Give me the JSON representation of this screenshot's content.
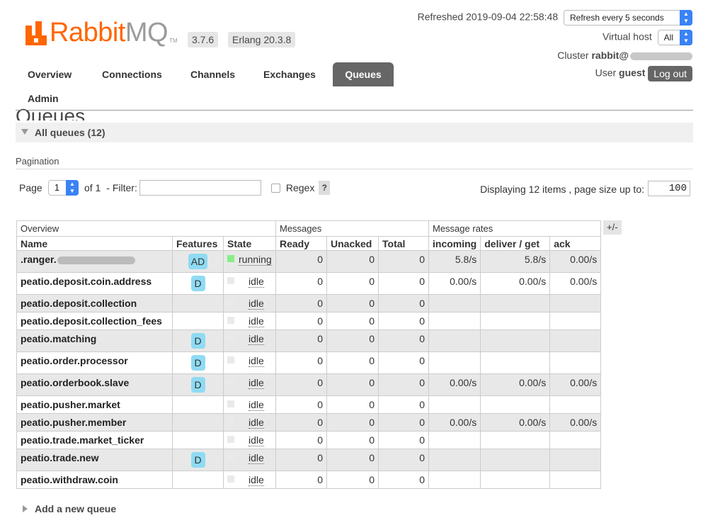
{
  "header": {
    "logo_main": "Rabbit",
    "logo_mq": "MQ",
    "logo_tm": "TM",
    "version": "3.7.6",
    "erlang": "Erlang 20.3.8",
    "refreshed": "Refreshed 2019-09-04 22:58:48",
    "refresh_select": "Refresh every 5 seconds",
    "vhost_label": "Virtual host",
    "vhost_value": "All",
    "cluster_label": "Cluster",
    "cluster_value": "rabbit@",
    "user_label": "User",
    "user_value": "guest",
    "logout": "Log out"
  },
  "tabs": [
    "Overview",
    "Connections",
    "Channels",
    "Exchanges",
    "Queues",
    "Admin"
  ],
  "page": {
    "title": "Queues",
    "section": "All queues (12)",
    "pagination_label": "Pagination",
    "page_label": "Page",
    "page_value": "1",
    "of_label": "of 1",
    "filter_label": "- Filter:",
    "regex_label": "Regex",
    "help": "?",
    "display_info": "Displaying 12 items , page size up to:",
    "page_size": "100",
    "plusminus": "+/-",
    "add_queue": "Add a new queue"
  },
  "table": {
    "groups": [
      "Overview",
      "Messages",
      "Message rates"
    ],
    "columns": [
      "Name",
      "Features",
      "State",
      "Ready",
      "Unacked",
      "Total",
      "incoming",
      "deliver / get",
      "ack"
    ],
    "rows": [
      {
        "name": ".ranger.",
        "feature": "AD",
        "state": "running",
        "ready": "0",
        "unacked": "0",
        "total": "0",
        "incoming": "5.8/s",
        "deliver": "5.8/s",
        "ack": "0.00/s"
      },
      {
        "name": "peatio.deposit.coin.address",
        "feature": "D",
        "state": "idle",
        "ready": "0",
        "unacked": "0",
        "total": "0",
        "incoming": "0.00/s",
        "deliver": "0.00/s",
        "ack": "0.00/s"
      },
      {
        "name": "peatio.deposit.collection",
        "feature": "",
        "state": "idle",
        "ready": "0",
        "unacked": "0",
        "total": "0",
        "incoming": "",
        "deliver": "",
        "ack": ""
      },
      {
        "name": "peatio.deposit.collection_fees",
        "feature": "",
        "state": "idle",
        "ready": "0",
        "unacked": "0",
        "total": "0",
        "incoming": "",
        "deliver": "",
        "ack": ""
      },
      {
        "name": "peatio.matching",
        "feature": "D",
        "state": "idle",
        "ready": "0",
        "unacked": "0",
        "total": "0",
        "incoming": "",
        "deliver": "",
        "ack": ""
      },
      {
        "name": "peatio.order.processor",
        "feature": "D",
        "state": "idle",
        "ready": "0",
        "unacked": "0",
        "total": "0",
        "incoming": "",
        "deliver": "",
        "ack": ""
      },
      {
        "name": "peatio.orderbook.slave",
        "feature": "D",
        "state": "idle",
        "ready": "0",
        "unacked": "0",
        "total": "0",
        "incoming": "0.00/s",
        "deliver": "0.00/s",
        "ack": "0.00/s"
      },
      {
        "name": "peatio.pusher.market",
        "feature": "",
        "state": "idle",
        "ready": "0",
        "unacked": "0",
        "total": "0",
        "incoming": "",
        "deliver": "",
        "ack": ""
      },
      {
        "name": "peatio.pusher.member",
        "feature": "",
        "state": "idle",
        "ready": "0",
        "unacked": "0",
        "total": "0",
        "incoming": "0.00/s",
        "deliver": "0.00/s",
        "ack": "0.00/s"
      },
      {
        "name": "peatio.trade.market_ticker",
        "feature": "",
        "state": "idle",
        "ready": "0",
        "unacked": "0",
        "total": "0",
        "incoming": "",
        "deliver": "",
        "ack": ""
      },
      {
        "name": "peatio.trade.new",
        "feature": "D",
        "state": "idle",
        "ready": "0",
        "unacked": "0",
        "total": "0",
        "incoming": "",
        "deliver": "",
        "ack": ""
      },
      {
        "name": "peatio.withdraw.coin",
        "feature": "",
        "state": "idle",
        "ready": "0",
        "unacked": "0",
        "total": "0",
        "incoming": "",
        "deliver": "",
        "ack": ""
      }
    ]
  },
  "colors": {
    "brand": "#ff6600",
    "tab_active": "#666666",
    "feature_badge": "#8fdbf3",
    "running": "#88ee88",
    "select_accent": "#3b82f6"
  }
}
